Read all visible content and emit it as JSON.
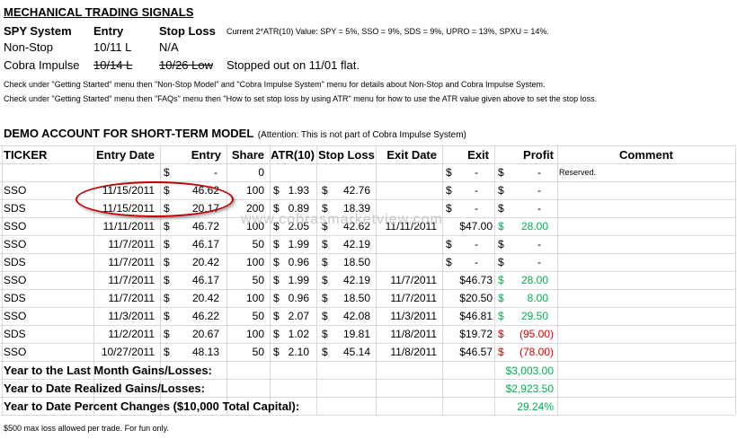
{
  "header": {
    "title": "MECHANICAL TRADING SIGNALS",
    "col1": "SPY System",
    "col2": "Entry",
    "col3": "Stop Loss",
    "atr_note": "Current 2*ATR(10) Value: SPY = 5%, SSO = 9%, SDS = 9%, UPRO = 13%, SPXU = 14%."
  },
  "systems": [
    {
      "name": "Non-Stop",
      "entry": "10/11 L",
      "stop": "N/A",
      "note": ""
    },
    {
      "name": "Cobra Impulse",
      "entry": "10/14 L",
      "stop": "10/26 Low",
      "note": "Stopped out on 11/01 flat."
    }
  ],
  "notes": [
    "Check under \"Getting Started\" menu then \"Non-Stop Model\" and \"Cobra Impulse System\" menu  for details about Non-Stop and Cobra Impulse System.",
    "Check under \"Getting Started\" menu then \"FAQs\" menu then \"How to set stop loss by using ATR\" menu for how to use the ATR value given above to set the stop loss."
  ],
  "demo": {
    "title": "DEMO ACCOUNT FOR SHORT-TERM MODEL",
    "attention": "(Attention: This is not part of Cobra Impulse System)"
  },
  "columns": [
    "TICKER",
    "Entry Date",
    "Entry",
    "Share",
    "ATR(10)",
    "Stop Loss",
    "Exit Date",
    "Exit",
    "Profit",
    "Comment"
  ],
  "reserved_row": {
    "dollar": "$",
    "entry": "-",
    "share": "0",
    "exit": "-",
    "profit": "-",
    "comment": "Reserved."
  },
  "rows": [
    {
      "ticker": "SSO",
      "entry_date": "11/15/2011",
      "entry": "46.62",
      "share": "100",
      "atr": "1.93",
      "stop": "42.76",
      "exit_date": "",
      "exit": "-",
      "profit": "-",
      "profit_color": "black"
    },
    {
      "ticker": "SDS",
      "entry_date": "11/15/2011",
      "entry": "20.17",
      "share": "200",
      "atr": "0.89",
      "stop": "18.39",
      "exit_date": "",
      "exit": "-",
      "profit": "-",
      "profit_color": "black"
    },
    {
      "ticker": "SSO",
      "entry_date": "11/11/2011",
      "entry": "46.72",
      "share": "100",
      "atr": "2.05",
      "stop": "42.62",
      "exit_date": "11/11/2011",
      "exit": "$47.00",
      "profit": "28.00",
      "profit_color": "green"
    },
    {
      "ticker": "SSO",
      "entry_date": "11/7/2011",
      "entry": "46.17",
      "share": "50",
      "atr": "1.99",
      "stop": "42.19",
      "exit_date": "",
      "exit": "-",
      "profit": "-",
      "profit_color": "black"
    },
    {
      "ticker": "SDS",
      "entry_date": "11/7/2011",
      "entry": "20.42",
      "share": "100",
      "atr": "0.96",
      "stop": "18.50",
      "exit_date": "",
      "exit": "-",
      "profit": "-",
      "profit_color": "black"
    },
    {
      "ticker": "SSO",
      "entry_date": "11/7/2011",
      "entry": "46.17",
      "share": "50",
      "atr": "1.99",
      "stop": "42.19",
      "exit_date": "11/7/2011",
      "exit": "$46.73",
      "profit": "28.00",
      "profit_color": "green"
    },
    {
      "ticker": "SDS",
      "entry_date": "11/7/2011",
      "entry": "20.42",
      "share": "100",
      "atr": "0.96",
      "stop": "18.50",
      "exit_date": "11/7/2011",
      "exit": "$20.50",
      "profit": "8.00",
      "profit_color": "green"
    },
    {
      "ticker": "SSO",
      "entry_date": "11/3/2011",
      "entry": "46.22",
      "share": "50",
      "atr": "2.07",
      "stop": "42.08",
      "exit_date": "11/3/2011",
      "exit": "$46.81",
      "profit": "29.50",
      "profit_color": "green"
    },
    {
      "ticker": "SDS",
      "entry_date": "11/2/2011",
      "entry": "20.67",
      "share": "100",
      "atr": "1.02",
      "stop": "19.81",
      "exit_date": "11/8/2011",
      "exit": "$19.72",
      "profit": "(95.00)",
      "profit_color": "red"
    },
    {
      "ticker": "SSO",
      "entry_date": "10/27/2011",
      "entry": "48.13",
      "share": "50",
      "atr": "2.10",
      "stop": "45.14",
      "exit_date": "11/8/2011",
      "exit": "$46.57",
      "profit": "(78.00)",
      "profit_color": "red"
    }
  ],
  "summary": [
    {
      "label": "Year to the Last Month Gains/Losses:",
      "value": "$3,003.00"
    },
    {
      "label": "Year to Date Realized Gains/Losses:",
      "value": "$2,923.50"
    },
    {
      "label": "Year to Date Percent Changes ($10,000 Total Capital):",
      "value": "29.24%"
    }
  ],
  "footer": "$500 max loss allowed per trade. For fun only.",
  "watermark": "www.cobrasmarketview.com",
  "dollar_sign": "$",
  "colors": {
    "green": "#00b050",
    "red": "#e00000",
    "circle": "#c00000"
  }
}
